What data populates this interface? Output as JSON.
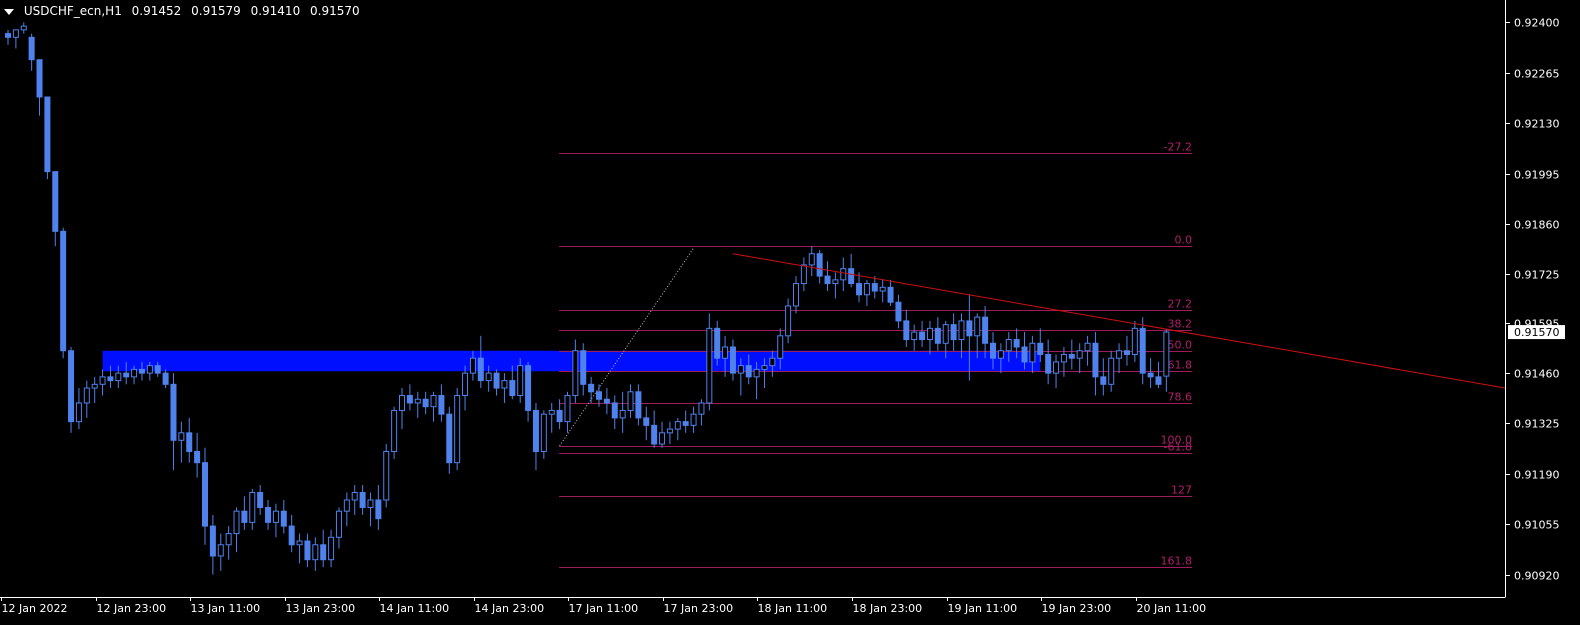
{
  "header": {
    "symbol": "USDCHF_ecn,H1",
    "open": "0.91452",
    "high": "0.91579",
    "low": "0.91410",
    "close": "0.91570"
  },
  "colors": {
    "background": "#000000",
    "axis": "#ffffff",
    "candle": "#4f82ec",
    "candle_wick": "#4f82ec",
    "zone": "#0010ff",
    "fib_line": "#9c1c5c",
    "fib_label": "#b01f6a",
    "trendline": "#d01010",
    "current_price_bg": "#ffffff",
    "current_price_text": "#000000"
  },
  "chart_data": {
    "type": "candlestick",
    "ylim": [
      0.9086,
      0.9246
    ],
    "y_ticks": [
      "0.92400",
      "0.92265",
      "0.92130",
      "0.91995",
      "0.91860",
      "0.91725",
      "0.91595",
      "0.91460",
      "0.91325",
      "0.91190",
      "0.91055",
      "0.90920"
    ],
    "x_ticks": [
      "12 Jan 2022",
      "12 Jan 23:00",
      "13 Jan 11:00",
      "13 Jan 23:00",
      "14 Jan 11:00",
      "14 Jan 23:00",
      "17 Jan 11:00",
      "17 Jan 23:00",
      "18 Jan 11:00",
      "18 Jan 23:00",
      "19 Jan 11:00",
      "19 Jan 23:00",
      "20 Jan 11:00"
    ],
    "x_tick_bar_index": [
      0,
      12,
      24,
      36,
      48,
      60,
      72,
      84,
      96,
      108,
      120,
      132,
      144
    ],
    "current_price": "0.91570",
    "candles": [
      [
        0.9237,
        0.9238,
        0.9234,
        0.9236
      ],
      [
        0.9236,
        0.9238,
        0.9233,
        0.9238
      ],
      [
        0.9238,
        0.924,
        0.9237,
        0.9239
      ],
      [
        0.9236,
        0.9237,
        0.9227,
        0.923
      ],
      [
        0.923,
        0.923,
        0.9215,
        0.922
      ],
      [
        0.922,
        0.922,
        0.9198,
        0.92
      ],
      [
        0.92,
        0.92,
        0.918,
        0.9184
      ],
      [
        0.9184,
        0.9185,
        0.915,
        0.9152
      ],
      [
        0.9152,
        0.9153,
        0.913,
        0.9133
      ],
      [
        0.9133,
        0.9142,
        0.9131,
        0.9138
      ],
      [
        0.9138,
        0.9144,
        0.9134,
        0.9142
      ],
      [
        0.9142,
        0.9145,
        0.9138,
        0.9143
      ],
      [
        0.9143,
        0.9147,
        0.914,
        0.9145
      ],
      [
        0.9145,
        0.9148,
        0.9142,
        0.9144
      ],
      [
        0.9144,
        0.9148,
        0.9142,
        0.9146
      ],
      [
        0.9146,
        0.9149,
        0.9143,
        0.9145
      ],
      [
        0.9145,
        0.9148,
        0.9143,
        0.9147
      ],
      [
        0.9147,
        0.9149,
        0.9144,
        0.9146
      ],
      [
        0.9146,
        0.9149,
        0.9144,
        0.9148
      ],
      [
        0.9148,
        0.9149,
        0.9145,
        0.9146
      ],
      [
        0.9146,
        0.9147,
        0.9142,
        0.9143
      ],
      [
        0.9143,
        0.9146,
        0.912,
        0.9128
      ],
      [
        0.9128,
        0.9133,
        0.9122,
        0.913
      ],
      [
        0.913,
        0.9134,
        0.9122,
        0.9125
      ],
      [
        0.9125,
        0.913,
        0.9118,
        0.9122
      ],
      [
        0.9122,
        0.9126,
        0.91,
        0.9105
      ],
      [
        0.9105,
        0.9108,
        0.9092,
        0.9097
      ],
      [
        0.9097,
        0.9103,
        0.9093,
        0.91
      ],
      [
        0.91,
        0.9105,
        0.9096,
        0.9103
      ],
      [
        0.9103,
        0.911,
        0.9098,
        0.9109
      ],
      [
        0.9109,
        0.9113,
        0.9104,
        0.9106
      ],
      [
        0.9106,
        0.9115,
        0.9104,
        0.9114
      ],
      [
        0.9114,
        0.9116,
        0.9108,
        0.911
      ],
      [
        0.911,
        0.9112,
        0.9104,
        0.9106
      ],
      [
        0.9106,
        0.9111,
        0.9102,
        0.9109
      ],
      [
        0.9109,
        0.9112,
        0.9103,
        0.9105
      ],
      [
        0.9105,
        0.9108,
        0.9098,
        0.91
      ],
      [
        0.91,
        0.9103,
        0.9095,
        0.9101
      ],
      [
        0.9101,
        0.9103,
        0.9094,
        0.9096
      ],
      [
        0.9096,
        0.9102,
        0.9093,
        0.91
      ],
      [
        0.91,
        0.9104,
        0.9094,
        0.9096
      ],
      [
        0.9096,
        0.9104,
        0.9094,
        0.9102
      ],
      [
        0.9102,
        0.911,
        0.9099,
        0.9109
      ],
      [
        0.9109,
        0.9114,
        0.9105,
        0.9112
      ],
      [
        0.9112,
        0.9116,
        0.9108,
        0.9114
      ],
      [
        0.9114,
        0.9116,
        0.9108,
        0.911
      ],
      [
        0.911,
        0.9114,
        0.9105,
        0.9112
      ],
      [
        0.9112,
        0.9116,
        0.9104,
        0.9107
      ],
      [
        0.9112,
        0.9127,
        0.911,
        0.9125
      ],
      [
        0.9125,
        0.9137,
        0.9123,
        0.9136
      ],
      [
        0.9136,
        0.9142,
        0.9131,
        0.914
      ],
      [
        0.914,
        0.9143,
        0.9136,
        0.9138
      ],
      [
        0.9138,
        0.9141,
        0.9134,
        0.9139
      ],
      [
        0.9139,
        0.9141,
        0.9135,
        0.9137
      ],
      [
        0.9137,
        0.9141,
        0.9133,
        0.914
      ],
      [
        0.914,
        0.9143,
        0.9133,
        0.9135
      ],
      [
        0.9135,
        0.9137,
        0.9119,
        0.9122
      ],
      [
        0.9122,
        0.9142,
        0.912,
        0.914
      ],
      [
        0.914,
        0.9148,
        0.9136,
        0.9146
      ],
      [
        0.9146,
        0.9152,
        0.9144,
        0.915
      ],
      [
        0.915,
        0.9156,
        0.9142,
        0.9144
      ],
      [
        0.9144,
        0.9148,
        0.9141,
        0.9146
      ],
      [
        0.9146,
        0.9147,
        0.914,
        0.9142
      ],
      [
        0.9142,
        0.9146,
        0.9138,
        0.9144
      ],
      [
        0.9144,
        0.9148,
        0.9139,
        0.914
      ],
      [
        0.914,
        0.915,
        0.9138,
        0.9148
      ],
      [
        0.9148,
        0.9149,
        0.9133,
        0.9136
      ],
      [
        0.9136,
        0.9138,
        0.912,
        0.9125
      ],
      [
        0.9125,
        0.9136,
        0.9123,
        0.9135
      ],
      [
        0.9135,
        0.9138,
        0.913,
        0.9136
      ],
      [
        0.9136,
        0.9139,
        0.9131,
        0.9133
      ],
      [
        0.9133,
        0.9141,
        0.913,
        0.914
      ],
      [
        0.914,
        0.9155,
        0.9138,
        0.9152
      ],
      [
        0.9152,
        0.9154,
        0.914,
        0.9143
      ],
      [
        0.9143,
        0.9145,
        0.9138,
        0.9141
      ],
      [
        0.9141,
        0.9143,
        0.9137,
        0.9139
      ],
      [
        0.9139,
        0.9142,
        0.9135,
        0.9138
      ],
      [
        0.9138,
        0.914,
        0.9131,
        0.9134
      ],
      [
        0.9134,
        0.9141,
        0.913,
        0.9136
      ],
      [
        0.9136,
        0.9143,
        0.9134,
        0.9141
      ],
      [
        0.9141,
        0.9143,
        0.9132,
        0.9134
      ],
      [
        0.9134,
        0.9137,
        0.9128,
        0.9132
      ],
      [
        0.9132,
        0.9136,
        0.9126,
        0.9127
      ],
      [
        0.9127,
        0.9133,
        0.9126,
        0.913
      ],
      [
        0.913,
        0.9133,
        0.9127,
        0.9131
      ],
      [
        0.9131,
        0.9134,
        0.9128,
        0.9133
      ],
      [
        0.9133,
        0.9136,
        0.913,
        0.9132
      ],
      [
        0.9132,
        0.9137,
        0.913,
        0.9135
      ],
      [
        0.9135,
        0.9139,
        0.9132,
        0.9138
      ],
      [
        0.9138,
        0.9162,
        0.9136,
        0.9158
      ],
      [
        0.9158,
        0.916,
        0.9148,
        0.915
      ],
      [
        0.915,
        0.9156,
        0.9145,
        0.9153
      ],
      [
        0.9153,
        0.9155,
        0.9144,
        0.9146
      ],
      [
        0.9146,
        0.915,
        0.914,
        0.9148
      ],
      [
        0.9148,
        0.9151,
        0.9143,
        0.9145
      ],
      [
        0.9145,
        0.9149,
        0.9139,
        0.9147
      ],
      [
        0.9147,
        0.915,
        0.9142,
        0.9148
      ],
      [
        0.9148,
        0.9152,
        0.9145,
        0.915
      ],
      [
        0.915,
        0.9158,
        0.9147,
        0.9156
      ],
      [
        0.9156,
        0.9166,
        0.9154,
        0.9164
      ],
      [
        0.9164,
        0.9172,
        0.9162,
        0.917
      ],
      [
        0.917,
        0.9177,
        0.9168,
        0.9175
      ],
      [
        0.9175,
        0.918,
        0.9172,
        0.9178
      ],
      [
        0.9178,
        0.9179,
        0.917,
        0.9172
      ],
      [
        0.9172,
        0.9176,
        0.9168,
        0.917
      ],
      [
        0.917,
        0.9173,
        0.9166,
        0.9171
      ],
      [
        0.9171,
        0.9177,
        0.9168,
        0.9174
      ],
      [
        0.9174,
        0.9178,
        0.9169,
        0.917
      ],
      [
        0.917,
        0.9173,
        0.9165,
        0.9167
      ],
      [
        0.9167,
        0.9171,
        0.9164,
        0.917
      ],
      [
        0.917,
        0.9172,
        0.9166,
        0.9168
      ],
      [
        0.9168,
        0.9171,
        0.9165,
        0.9169
      ],
      [
        0.9169,
        0.9171,
        0.9164,
        0.9165
      ],
      [
        0.9165,
        0.9167,
        0.9158,
        0.916
      ],
      [
        0.916,
        0.9163,
        0.9153,
        0.9155
      ],
      [
        0.9155,
        0.9159,
        0.9152,
        0.9157
      ],
      [
        0.9157,
        0.916,
        0.9153,
        0.9155
      ],
      [
        0.9155,
        0.916,
        0.9151,
        0.9158
      ],
      [
        0.9158,
        0.9161,
        0.9152,
        0.9154
      ],
      [
        0.9154,
        0.916,
        0.915,
        0.9159
      ],
      [
        0.9159,
        0.9162,
        0.9152,
        0.9155
      ],
      [
        0.9155,
        0.9162,
        0.915,
        0.916
      ],
      [
        0.916,
        0.9167,
        0.9144,
        0.9156
      ],
      [
        0.9156,
        0.9162,
        0.915,
        0.9161
      ],
      [
        0.9161,
        0.9164,
        0.915,
        0.9154
      ],
      [
        0.9154,
        0.9157,
        0.9147,
        0.915
      ],
      [
        0.915,
        0.9154,
        0.9146,
        0.9152
      ],
      [
        0.9152,
        0.9157,
        0.9149,
        0.9155
      ],
      [
        0.9155,
        0.9158,
        0.915,
        0.9153
      ],
      [
        0.9153,
        0.9157,
        0.9147,
        0.9149
      ],
      [
        0.9149,
        0.9156,
        0.9146,
        0.9154
      ],
      [
        0.9154,
        0.9158,
        0.9149,
        0.9151
      ],
      [
        0.9151,
        0.9155,
        0.9143,
        0.9146
      ],
      [
        0.9146,
        0.9151,
        0.9142,
        0.9149
      ],
      [
        0.9149,
        0.9153,
        0.9145,
        0.9151
      ],
      [
        0.9151,
        0.9155,
        0.9147,
        0.915
      ],
      [
        0.915,
        0.9154,
        0.9146,
        0.9152
      ],
      [
        0.9152,
        0.9156,
        0.9148,
        0.9154
      ],
      [
        0.9154,
        0.9157,
        0.914,
        0.9145
      ],
      [
        0.9145,
        0.915,
        0.914,
        0.9143
      ],
      [
        0.9143,
        0.9152,
        0.9141,
        0.915
      ],
      [
        0.915,
        0.9154,
        0.9146,
        0.9152
      ],
      [
        0.9152,
        0.9156,
        0.9148,
        0.9151
      ],
      [
        0.9151,
        0.916,
        0.9149,
        0.9158
      ],
      [
        0.9158,
        0.9161,
        0.9143,
        0.9146
      ],
      [
        0.9146,
        0.915,
        0.9142,
        0.9145
      ],
      [
        0.9145,
        0.9149,
        0.9142,
        0.9143
      ],
      [
        0.91452,
        0.91579,
        0.9141,
        0.9157
      ]
    ],
    "zone": {
      "from_bar": 12,
      "to_bar": 131,
      "y_top": 0.9152,
      "y_bottom": 0.91465
    },
    "fibonacci": {
      "from_bar": 70,
      "label_bar": 150,
      "levels": [
        {
          "label": "-61.8",
          "price": 0.91245
        },
        {
          "label": "-27.2",
          "price": 0.9205
        },
        {
          "label": "0.0",
          "price": 0.918
        },
        {
          "label": "27.2",
          "price": 0.9163
        },
        {
          "label": "38.2",
          "price": 0.91575
        },
        {
          "label": "50.0",
          "price": 0.9152
        },
        {
          "label": "61.8",
          "price": 0.91465
        },
        {
          "label": "78.6",
          "price": 0.9138
        },
        {
          "label": "100.0",
          "price": 0.91265
        },
        {
          "label": "127",
          "price": 0.9113
        },
        {
          "label": "161.8",
          "price": 0.9094
        }
      ]
    },
    "fib_anchor_line": {
      "x1_bar": 70,
      "y1": 0.91265,
      "x2_bar": 87,
      "y2": 0.91795
    },
    "trendline": {
      "x1_bar": 92,
      "y1": 0.9178,
      "x2_bar": 156,
      "y2": 0.9142
    }
  }
}
